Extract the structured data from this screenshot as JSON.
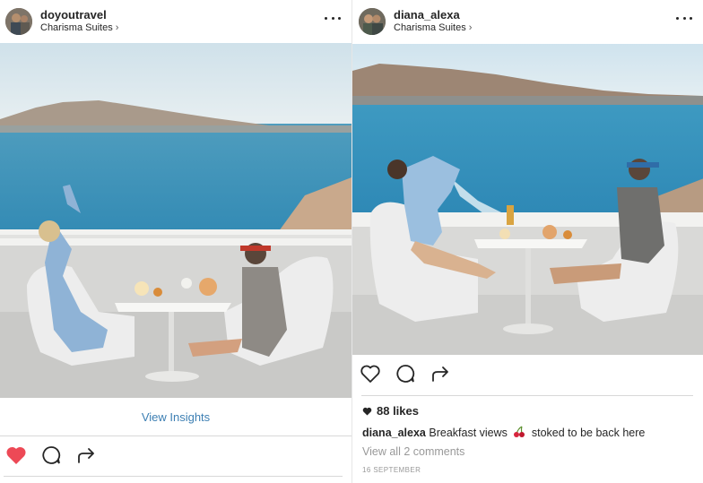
{
  "left_post": {
    "username": "doyoutravel",
    "location": "Charisma Suites",
    "insights_label": "View Insights",
    "liked": true,
    "like_color": "#ed4956"
  },
  "right_post": {
    "username": "diana_alexa",
    "location": "Charisma Suites",
    "likes": "88 likes",
    "caption_user": "diana_alexa",
    "caption_text_before": "Breakfast views",
    "caption_emoji": "cherries-emoji",
    "caption_text_after": "stoked to be back here",
    "comments_label": "View all 2 comments",
    "date": "16 SEPTEMBER",
    "liked": false
  },
  "icons": {
    "location_chevron": "chevron-right-icon",
    "more": "more-options-icon",
    "like": "heart-icon",
    "comment": "comment-icon",
    "share": "share-icon"
  },
  "colors": {
    "link_blue": "#3d7fb3",
    "sea": "#3a93b8",
    "sky": "#dcecf2",
    "muted_text": "#999999"
  }
}
